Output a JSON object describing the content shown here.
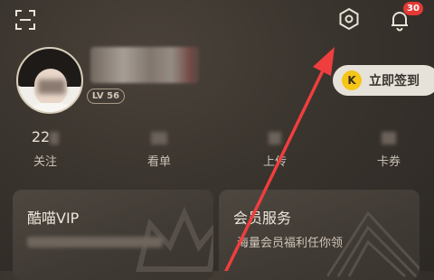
{
  "header": {
    "notification_count": "30"
  },
  "profile": {
    "level": "LV 56"
  },
  "checkin": {
    "label": "立即签到",
    "coin_letter": "K"
  },
  "stats": [
    {
      "value": "22",
      "label": "关注"
    },
    {
      "value": "",
      "label": "看单"
    },
    {
      "value": "",
      "label": "上传"
    },
    {
      "value": "",
      "label": "卡券"
    }
  ],
  "cards": {
    "vip": {
      "title": "酷喵VIP"
    },
    "member": {
      "title": "会员服务",
      "subtitle": "海量会员福利任你领"
    }
  },
  "colors": {
    "accent_red": "#ef3e3e",
    "badge_red": "#e53935",
    "coin_yellow": "#f5c518"
  }
}
